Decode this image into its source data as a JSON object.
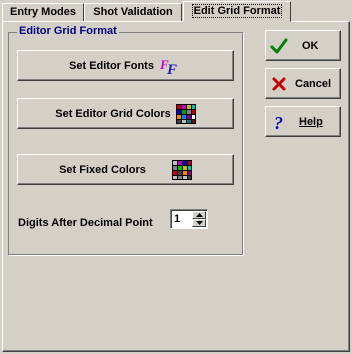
{
  "tabs": [
    {
      "label": "Entry Modes"
    },
    {
      "label": "Shot Validation"
    },
    {
      "label": "Edit Grid Format",
      "active": true
    }
  ],
  "group": {
    "title": "Editor Grid Format",
    "buttons": {
      "fonts": {
        "label": "Set Editor Fonts",
        "icon": "font-icon"
      },
      "grid_colors": {
        "label": "Set Editor Grid Colors",
        "icon": "color-grid-icon"
      },
      "fixed_colors": {
        "label": "Set Fixed Colors",
        "icon": "color-grid-icon"
      }
    },
    "digits": {
      "label": "Digits After Decimal Point",
      "value": "1"
    }
  },
  "actions": {
    "ok": {
      "label": "OK",
      "icon": "check-icon",
      "color": "#008000"
    },
    "cancel": {
      "label": "Cancel",
      "icon": "x-icon",
      "color": "#c00000"
    },
    "help": {
      "label": "Help",
      "icon": "question-icon",
      "color": "#0000c0"
    }
  },
  "colors": {
    "dialog_bg": "#d4d0c8",
    "group_title": "#000080"
  }
}
